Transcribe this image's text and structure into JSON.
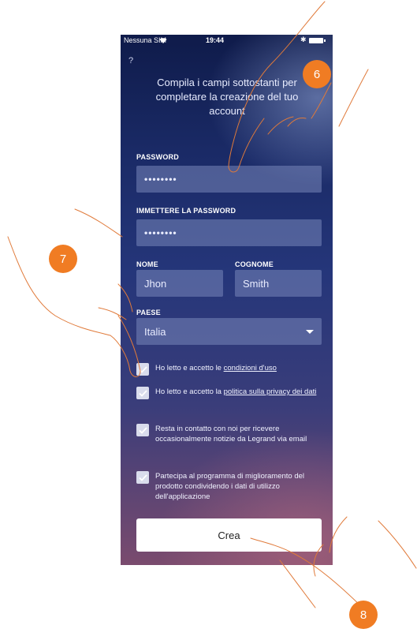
{
  "status_bar": {
    "carrier": "Nessuna SIM",
    "time": "19:44"
  },
  "help_label": "?",
  "intro_text": "Compila i campi sottostanti per completare la creazione del tuo account",
  "password": {
    "label": "PASSWORD",
    "value": "••••••••"
  },
  "password_confirm": {
    "label": "IMMETTERE LA PASSWORD",
    "value": "••••••••"
  },
  "first_name": {
    "label": "NOME",
    "value": "Jhon"
  },
  "last_name": {
    "label": "COGNOME",
    "value": "Smith"
  },
  "country": {
    "label": "PAESE",
    "value": "Italia"
  },
  "checkboxes": [
    {
      "prefix": "Ho letto e accetto le ",
      "link": "condizioni d'uso",
      "checked": true
    },
    {
      "prefix": "Ho letto e accetto la ",
      "link": "politica sulla privacy dei dati",
      "checked": true
    },
    {
      "text": "Resta in contatto con noi per ricevere occasionalmente notizie da Legrand via email",
      "checked": true
    },
    {
      "text": "Partecipa al programma di miglioramento del prodotto condividendo i dati di utilizzo dell'applicazione",
      "checked": true
    }
  ],
  "create_button": "Crea",
  "step_markers": [
    "6",
    "7",
    "8"
  ],
  "colors": {
    "marker": "#f07c23",
    "field": "#7887b9"
  }
}
